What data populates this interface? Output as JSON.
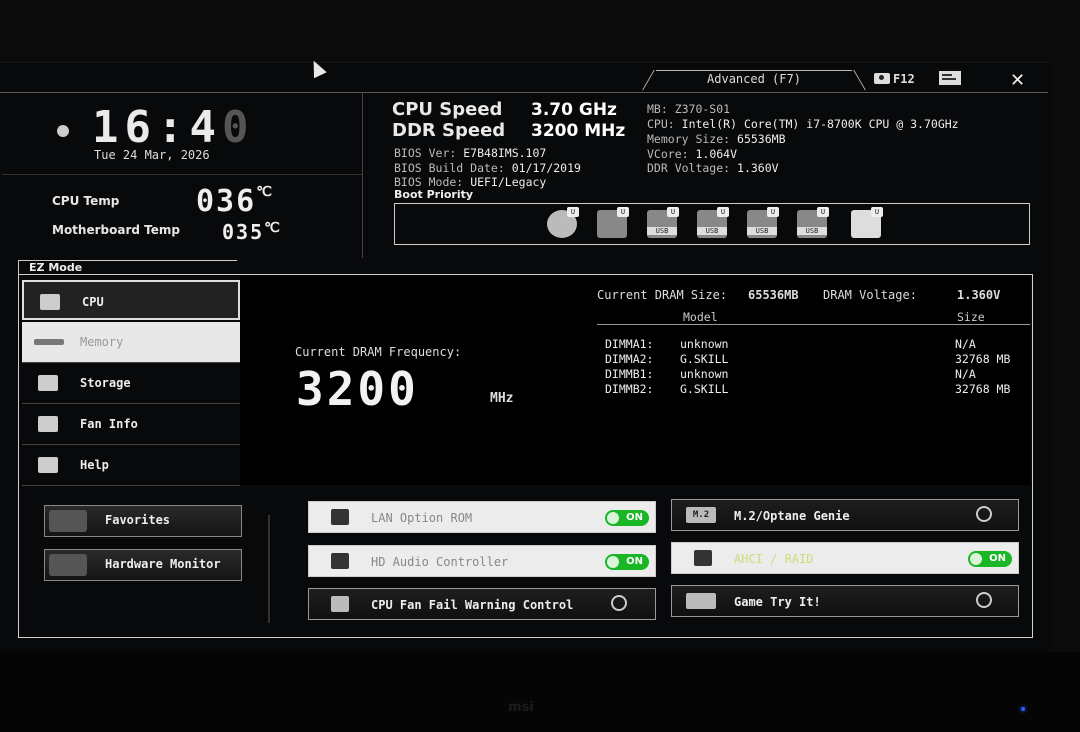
{
  "topbar": {
    "advanced_label": "Advanced (F7)",
    "f12_label": "F12",
    "close_label": "✕"
  },
  "clock": {
    "time_on": "16:4",
    "time_dim": "0",
    "date": "Tue  24 Mar, 2026"
  },
  "temps": {
    "cpu_label": "CPU Temp",
    "cpu_value": "036",
    "cpu_unit": "℃",
    "mb_label": "Motherboard Temp",
    "mb_value": "035",
    "mb_unit": "℃"
  },
  "speed": {
    "cpu_label": "CPU Speed",
    "cpu_value": "3.70 GHz",
    "ddr_label": "DDR Speed",
    "ddr_value": "3200 MHz"
  },
  "bios": {
    "ver_label": "BIOS Ver:",
    "ver_value": "E7B48IMS.107",
    "date_label": "BIOS Build Date:",
    "date_value": "01/17/2019",
    "mode_label": "BIOS Mode:",
    "mode_value": "UEFI/Legacy",
    "boot_label": "Boot Priority"
  },
  "sysinfo": {
    "mb": "MB: Z370-S01",
    "cpu_label": "CPU:",
    "cpu_value": "Intel(R) Core(TM) i7-8700K CPU @ 3.70GHz",
    "mem_label": "Memory Size:",
    "mem_value": "65536MB",
    "vcore_label": "VCore:",
    "vcore_value": "1.064V",
    "ddrv_label": "DDR Voltage:",
    "ddrv_value": "1.360V"
  },
  "boot_devices": [
    {
      "tag": ""
    },
    {
      "tag": ""
    },
    {
      "tag": "USB"
    },
    {
      "tag": "USB"
    },
    {
      "tag": "USB"
    },
    {
      "tag": "USB"
    },
    {
      "tag": ""
    }
  ],
  "ez": {
    "tab_label": "EZ Mode",
    "nav": [
      {
        "label": "CPU"
      },
      {
        "label": "Memory"
      },
      {
        "label": "Storage"
      },
      {
        "label": "Fan Info"
      },
      {
        "label": "Help"
      }
    ]
  },
  "memory": {
    "cur_freq_label": "Current DRAM Frequency:",
    "freq_value": "3200",
    "freq_unit": "MHz",
    "dram_size_label": "Current DRAM Size:",
    "dram_size_value": "65536MB",
    "dram_volt_label": "DRAM Voltage:",
    "dram_volt_value": "1.360V",
    "col_model": "Model",
    "col_size": "Size",
    "slots": [
      {
        "slot": "DIMMA1:",
        "model": "unknown",
        "size": "N/A"
      },
      {
        "slot": "DIMMA2:",
        "model": "G.SKILL",
        "size": "32768 MB"
      },
      {
        "slot": "DIMMB1:",
        "model": "unknown",
        "size": "N/A"
      },
      {
        "slot": "DIMMB2:",
        "model": "G.SKILL",
        "size": "32768 MB"
      }
    ]
  },
  "bottom": {
    "favorites": "Favorites",
    "hw_monitor": "Hardware Monitor",
    "lan": "LAN Option ROM",
    "hd_audio": "HD Audio Controller",
    "cpu_fan": "CPU Fan Fail Warning Control",
    "m2": "M.2/Optane Genie",
    "m2_badge": "M.2",
    "ahci": "AHCI / RAID",
    "game": "Game Try It!",
    "on_label": "ON"
  },
  "colors": {
    "toggle_on": "#19b626",
    "accent_text": "#c9e07a"
  }
}
